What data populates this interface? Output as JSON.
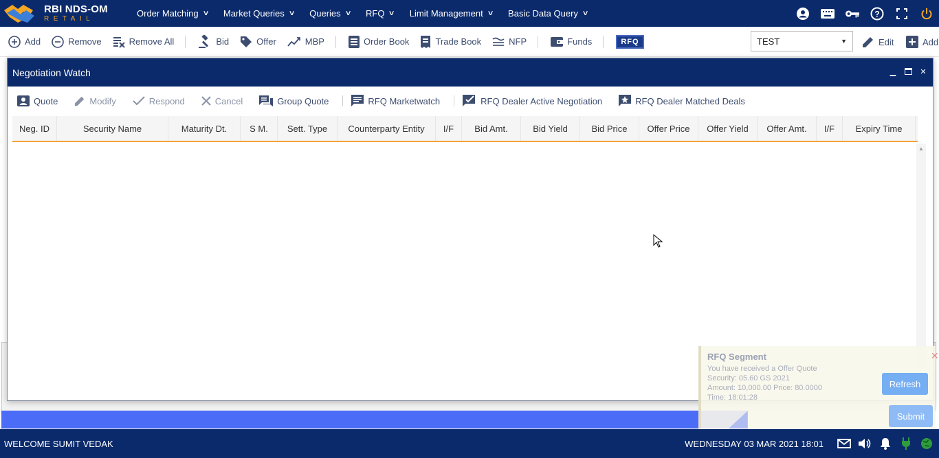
{
  "app": {
    "logo_title": "RBI NDS-OM",
    "logo_sub": "RETAIL"
  },
  "menu": [
    {
      "label": "Order Matching"
    },
    {
      "label": "Market Queries"
    },
    {
      "label": "Queries"
    },
    {
      "label": "RFQ"
    },
    {
      "label": "Limit Management"
    },
    {
      "label": "Basic Data Query"
    }
  ],
  "top_icons": [
    "user-icon",
    "keyboard-icon",
    "key-icon",
    "help-icon",
    "fullscreen-icon",
    "power-icon"
  ],
  "toolbar": {
    "add": "Add",
    "remove": "Remove",
    "remove_all": "Remove All",
    "bid": "Bid",
    "offer": "Offer",
    "mbp": "MBP",
    "order_book": "Order Book",
    "trade_book": "Trade Book",
    "nfp": "NFP",
    "funds": "Funds",
    "rfq_badge": "RFQ",
    "select_value": "TEST",
    "edit": "Edit",
    "add_right": "Add"
  },
  "dialog": {
    "title": "Negotiation Watch",
    "actions": {
      "quote": "Quote",
      "modify": "Modify",
      "respond": "Respond",
      "cancel": "Cancel",
      "group_quote": "Group Quote",
      "rfq_marketwatch": "RFQ Marketwatch",
      "rfq_dealer_active": "RFQ Dealer Active Negotiation",
      "rfq_dealer_matched": "RFQ Dealer Matched Deals"
    },
    "columns": [
      "Neg. ID",
      "Security Name",
      "Maturity Dt.",
      "S M.",
      "Sett. Type",
      "Counterparty Entity",
      "I/F",
      "Bid Amt.",
      "Bid Yield",
      "Bid Price",
      "Offer Price",
      "Offer Yield",
      "Offer Amt.",
      "I/F",
      "Expiry Time"
    ]
  },
  "notification": {
    "title": "RFQ Segment",
    "line1": "You have received a Offer Quote",
    "line2": "Security: 05.60 GS 2021",
    "line3": "Amount: 10,000.00 Price: 80.0000",
    "line4": "Time: 18:01:28",
    "refresh": "Refresh",
    "submit": "Submit"
  },
  "status": {
    "welcome": "WELCOME SUMIT VEDAK",
    "datetime": "WEDNESDAY 03 MAR 2021 18:01"
  },
  "colors": {
    "navy": "#0b2a6b",
    "accent_orange": "#f0a23a",
    "button_blue": "#76aef3"
  }
}
